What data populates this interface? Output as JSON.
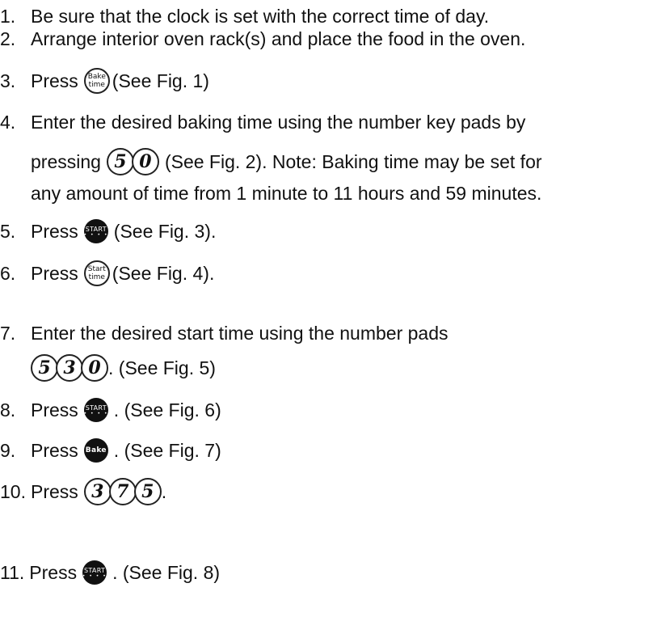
{
  "steps": [
    {
      "num": "1.",
      "text": "Be sure that the clock is set with the correct time of day."
    },
    {
      "num": "2.",
      "text": "Arrange interior oven rack(s) and place the food in the oven."
    },
    {
      "num": "3.",
      "press": "Press",
      "tail": "(See Fig. 1)"
    },
    {
      "num": "4.",
      "line1": "Enter the desired baking time using the number key pads by",
      "pressing": "pressing",
      "tail": "(See Fig. 2). Note: Baking time may be set for",
      "line3": "any amount of time from 1 minute to 11 hours and 59 minutes."
    },
    {
      "num": "5.",
      "press": "Press",
      "tail": "(See Fig. 3)."
    },
    {
      "num": "6.",
      "press": "Press",
      "tail": "(See Fig. 4)."
    },
    {
      "num": "7.",
      "line1": "Enter the desired start time using the number pads",
      "tail": ". (See Fig. 5)"
    },
    {
      "num": "8.",
      "press": "Press",
      "tail": ". (See Fig. 6)"
    },
    {
      "num": "9.",
      "press": "Press",
      "tail": ". (See Fig. 7)"
    },
    {
      "num": "10.",
      "press": "Press",
      "tail": "."
    },
    {
      "num": "11.",
      "press": "Press",
      "tail": ". (See Fig. 8)"
    }
  ],
  "pads": {
    "bake_time": [
      "Bake",
      "time"
    ],
    "start_time": [
      "Start",
      "time"
    ],
    "start": "START",
    "start_dots": "• • • •",
    "bake": "Bake",
    "digits_step4": [
      "5",
      "0"
    ],
    "digits_step7": [
      "5",
      "3",
      "0"
    ],
    "digits_step10": [
      "3",
      "7",
      "5"
    ]
  }
}
